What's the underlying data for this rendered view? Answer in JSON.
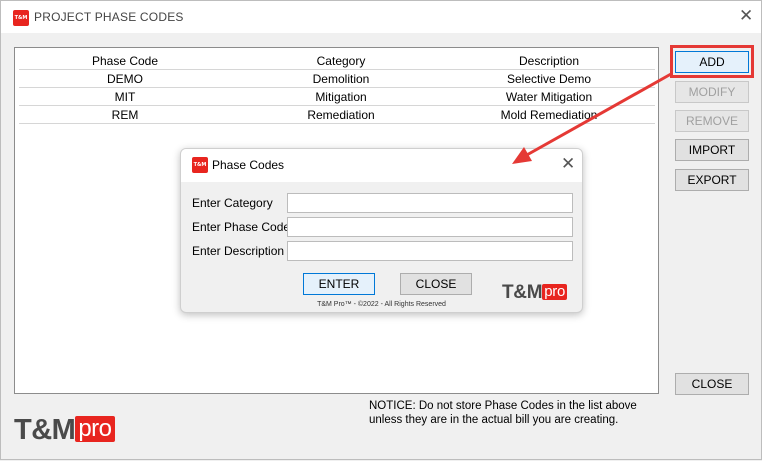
{
  "window": {
    "title": "PROJECT PHASE CODES",
    "app_icon_text": "T&M",
    "close_glyph": "✕"
  },
  "table": {
    "headers": [
      "Phase Code",
      "Category",
      "Description"
    ],
    "rows": [
      [
        "DEMO",
        "Demolition",
        "Selective Demo"
      ],
      [
        "MIT",
        "Mitigation",
        "Water Mitigation"
      ],
      [
        "REM",
        "Remediation",
        "Mold Remediation"
      ]
    ]
  },
  "buttons": {
    "add": "ADD",
    "modify": "MODIFY",
    "remove": "REMOVE",
    "import": "IMPORT",
    "export": "EXPORT",
    "close": "CLOSE"
  },
  "notice": "NOTICE:  Do not store Phase Codes in the list above unless they are in the actual bill you are creating.",
  "logo": {
    "tm": "T&M",
    "pro": "pro"
  },
  "dialog": {
    "title": "Phase Codes",
    "app_icon_text": "T&M",
    "close_glyph": "✕",
    "labels": {
      "category": "Enter Category",
      "phase_code": "Enter Phase Code",
      "description": "Enter Description"
    },
    "values": {
      "category": "",
      "phase_code": "",
      "description": ""
    },
    "enter_button": "ENTER",
    "close_button": "CLOSE",
    "footer": "T&M Pro™ - ©2022 - All Rights Reserved",
    "logo": {
      "tm": "T&M",
      "pro": "pro"
    }
  },
  "colors": {
    "brand_red": "#e8251f",
    "highlight_red": "#e53935",
    "focus_blue": "#0078d7"
  }
}
